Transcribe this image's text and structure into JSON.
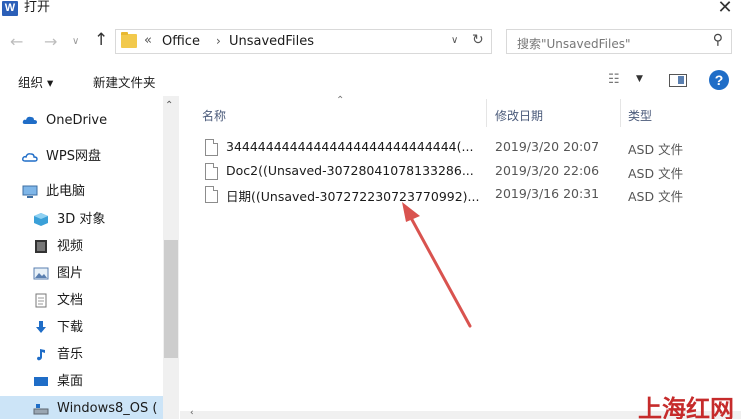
{
  "window": {
    "app_icon": "W",
    "title": "打开",
    "close_glyph": "✕"
  },
  "nav": {
    "back_glyph": "←",
    "forward_glyph": "→",
    "dropdown_glyph": "∨",
    "up_glyph": "↑"
  },
  "address": {
    "separator": "«",
    "crumbs": [
      "Office",
      "UnsavedFiles"
    ],
    "crumb_arrow": "›",
    "dropdown_glyph": "∨",
    "refresh_glyph": "↻"
  },
  "search": {
    "placeholder": "搜索\"UnsavedFiles\"",
    "icon": "search-icon",
    "glyph": "⚲"
  },
  "toolbar": {
    "organize": "组织 ▾",
    "new_folder": "新建文件夹",
    "view_glyph": "☷",
    "view_dd_glyph": "▼",
    "help_glyph": "?"
  },
  "sidebar": {
    "items": [
      {
        "label": "OneDrive",
        "icon": "cloud-icon"
      },
      {
        "label": "WPS网盘",
        "icon": "cloud-outline-icon"
      },
      {
        "label": "此电脑",
        "icon": "computer-icon"
      },
      {
        "label": "3D 对象",
        "icon": "cube-icon"
      },
      {
        "label": "视频",
        "icon": "video-icon"
      },
      {
        "label": "图片",
        "icon": "picture-icon"
      },
      {
        "label": "文档",
        "icon": "document-icon"
      },
      {
        "label": "下载",
        "icon": "download-icon"
      },
      {
        "label": "音乐",
        "icon": "music-icon"
      },
      {
        "label": "桌面",
        "icon": "desktop-icon"
      },
      {
        "label": "Windows8_OS (",
        "icon": "drive-icon"
      }
    ],
    "scroll_up_glyph": "⌃"
  },
  "columns": {
    "name": "名称",
    "date": "修改日期",
    "type": "类型",
    "sort_glyph": "⌃"
  },
  "files": [
    {
      "name": "34444444444444444444444444444(...",
      "date": "2019/3/20 20:07",
      "type": "ASD 文件"
    },
    {
      "name": "Doc2((Unsaved-30728041078133286...",
      "date": "2019/3/20 22:06",
      "type": "ASD 文件"
    },
    {
      "name": "日期((Unsaved-307272230723770992)...",
      "date": "2019/3/16 20:31",
      "type": "ASD 文件"
    }
  ],
  "hscroll_left_glyph": "‹",
  "watermark": "上海红网",
  "colors": {
    "accent_red": "#c62b2b",
    "selection": "#cce4f7",
    "help_blue": "#1f6dc7"
  }
}
